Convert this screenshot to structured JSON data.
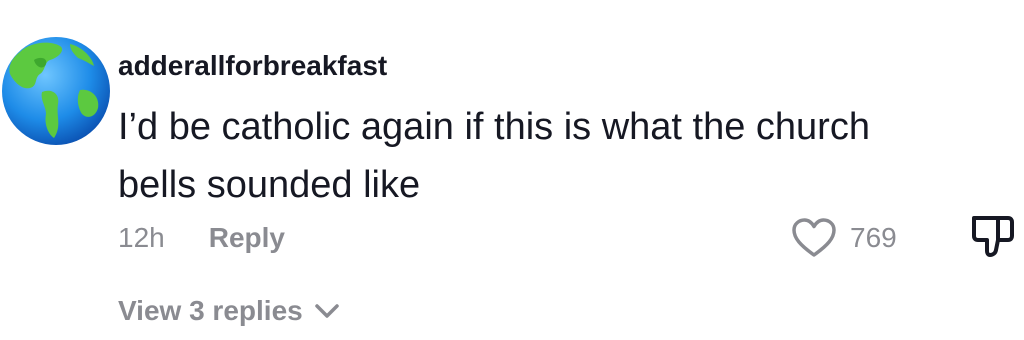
{
  "comment": {
    "username": "adderallforbreakfast",
    "text": "I’d be catholic again if this is what the church bells sounded like",
    "timestamp": "12h",
    "reply_label": "Reply",
    "like_count": "769",
    "view_replies_label": "View 3 replies"
  },
  "icons": {
    "avatar": "globe-emoji-avatar",
    "like": "heart-outline-icon",
    "dislike": "thumbs-down-outline-icon",
    "expand": "chevron-down-icon"
  },
  "colors": {
    "text_primary": "#161823",
    "text_secondary": "#8a8b91",
    "background": "#ffffff"
  }
}
